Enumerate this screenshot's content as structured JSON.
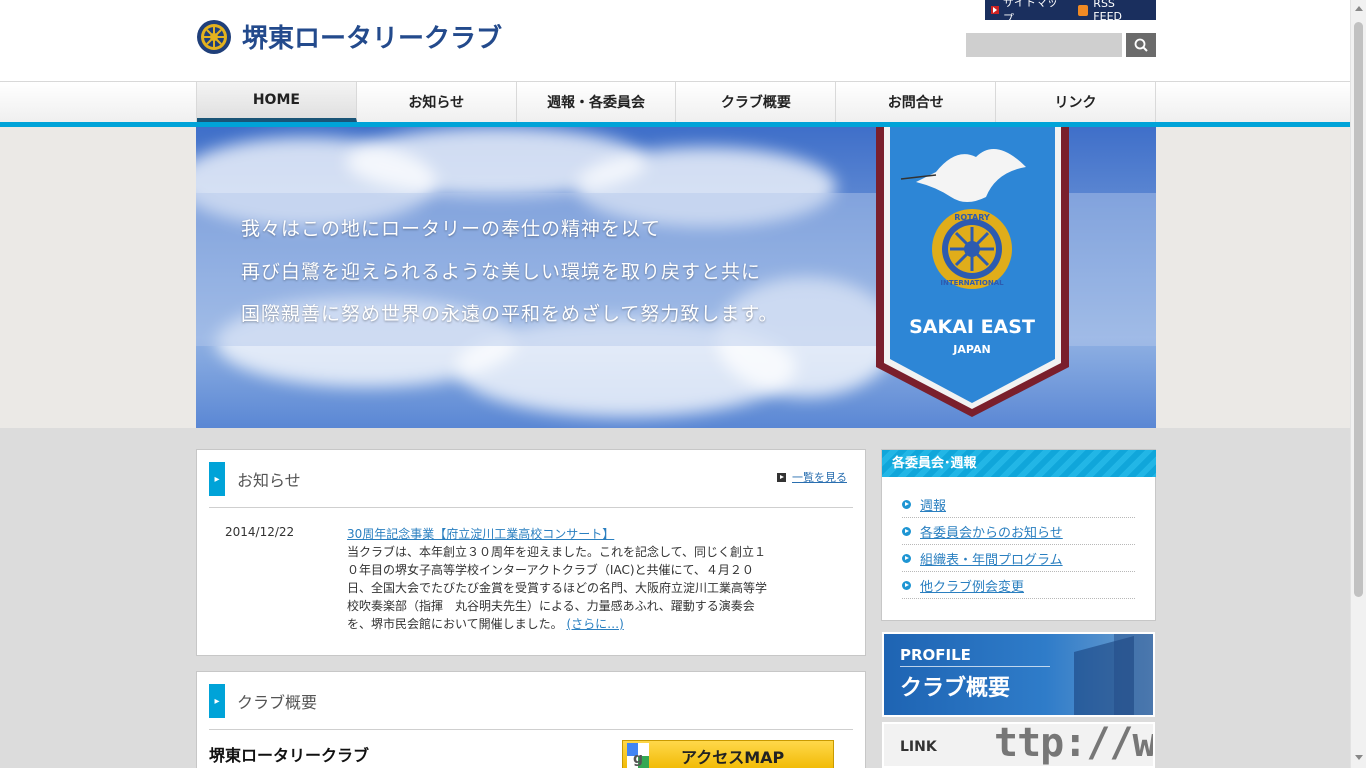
{
  "header": {
    "logo_text": "堺東ロータリークラブ",
    "sitemap": "サイトマップ",
    "rss": "RSS FEED",
    "search_placeholder": ""
  },
  "nav": [
    {
      "label": "HOME"
    },
    {
      "label": "お知らせ"
    },
    {
      "label": "週報・各委員会"
    },
    {
      "label": "クラブ概要"
    },
    {
      "label": "お問合せ"
    },
    {
      "label": "リンク"
    }
  ],
  "hero": {
    "lines": [
      "我々はこの地にロータリーの奉仕の精神を以て",
      "再び白鷺を迎えられるような美しい環境を取り戻すと共に",
      "国際親善に努め世界の永遠の平和をめざして努力致します。"
    ],
    "banner_title": "SAKAI EAST",
    "banner_sub": "JAPAN",
    "banner_ring_top": "ROTARY",
    "banner_ring_bottom": "INTERNATIONAL"
  },
  "news": {
    "title": "お知らせ",
    "more": "一覧を見る",
    "date": "2014/12/22",
    "item_title": "30周年記念事業【府立淀川工業高校コンサート】",
    "body_lines": [
      "当クラブは、本年創立３０周年を迎えました。これを記念して、同じく創立１",
      "０年目の堺女子高等学校インターアクトクラブ（IAC)と共催にて、４月２０",
      "日、全国大会でたびたび金賞を受賞するほどの名門、大阪府立淀川工業高等学",
      "校吹奏楽部（指揮　丸谷明夫先生）による、力量感あふれ、躍動する演奏会",
      "を、堺市民会館において開催しました。"
    ],
    "read_more": "(さらに…)"
  },
  "club": {
    "title": "クラブ概要",
    "name": "堺東ロータリークラブ",
    "access": "アクセスMAP"
  },
  "sidebar": {
    "head": "各委員会･週報",
    "items": [
      {
        "label": "週報"
      },
      {
        "label": "各委員会からのお知らせ"
      },
      {
        "label": "組織表・年間プログラム"
      },
      {
        "label": "他クラブ例会変更"
      }
    ],
    "profile_en": "PROFILE",
    "profile_jp": "クラブ概要",
    "link_en": "LINK",
    "link_deco": "ttp://ww"
  },
  "colors": {
    "accent": "#00a3d8",
    "navy": "#1a2f5e",
    "link": "#2a7fc0"
  }
}
